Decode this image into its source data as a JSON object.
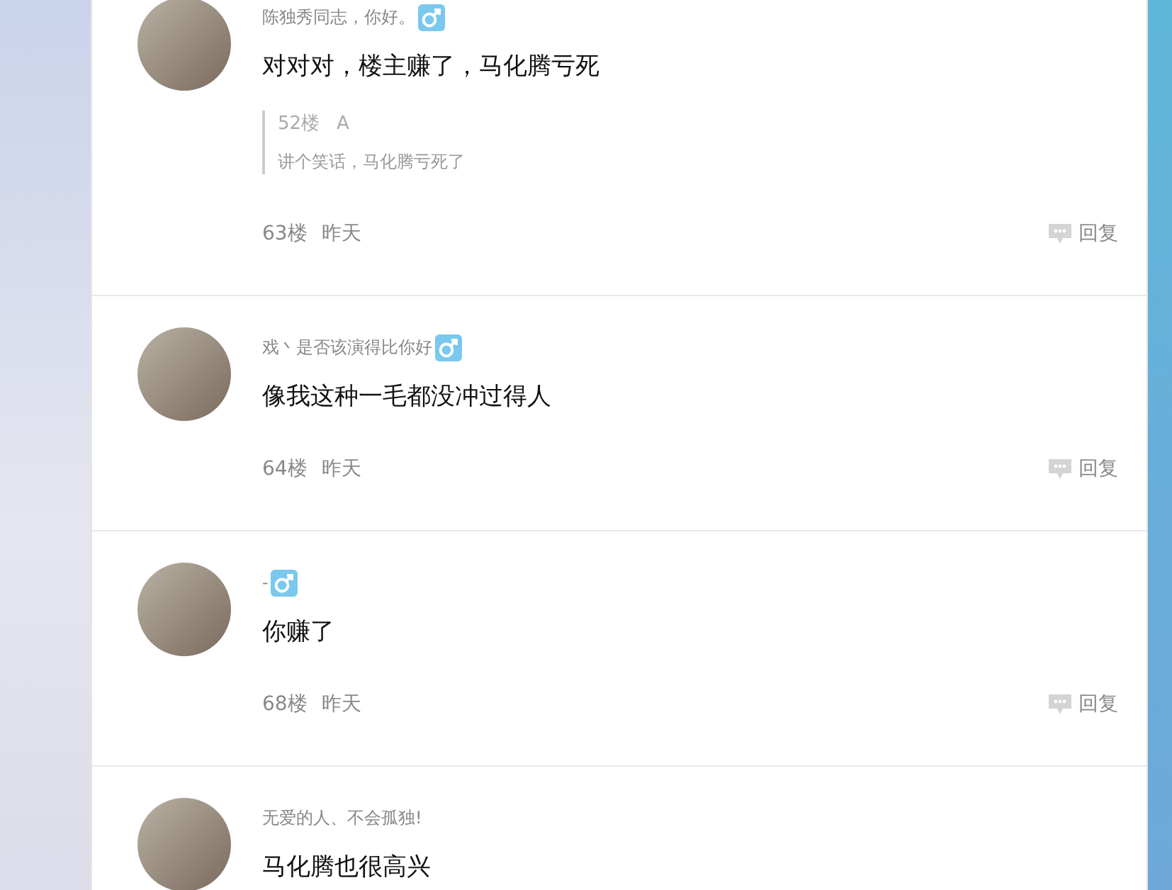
{
  "posts": [
    {
      "username": "陈独秀同志，你好。",
      "male_icon": true,
      "content": "对对对，楼主赚了，马化腾亏死",
      "quote": {
        "floor": "52楼",
        "author": "A",
        "text": "讲个笑话，马化腾亏死了"
      },
      "floor": "63楼",
      "time": "昨天",
      "reply": "回复"
    },
    {
      "username": "戏丶是否该演得比你好",
      "male_icon": true,
      "content": "像我这种一毛都没冲过得人",
      "floor": "64楼",
      "time": "昨天",
      "reply": "回复"
    },
    {
      "username": "-",
      "male_icon": true,
      "content": "你赚了",
      "floor": "68楼",
      "time": "昨天",
      "reply": "回复"
    },
    {
      "username": "无爱的人、不会孤独!",
      "male_icon": false,
      "content": "马化腾也很高兴"
    }
  ]
}
